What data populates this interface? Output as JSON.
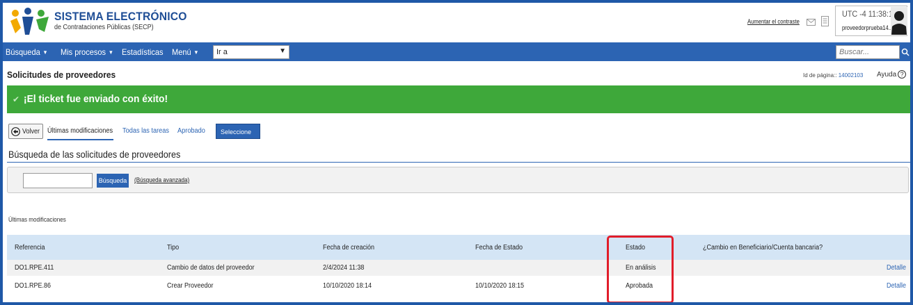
{
  "header": {
    "brand_title": "SISTEMA ELECTRÓNICO",
    "brand_subtitle": "de Contrataciones Públicas (SECP)",
    "contrast_link": "Aumentar el contraste",
    "time": "UTC -4 11:38:17",
    "username": "proveedorprueba14..."
  },
  "nav": {
    "items": [
      {
        "label": "Búsqueda",
        "caret": true
      },
      {
        "label": "Mis procesos",
        "caret": true
      },
      {
        "label": "Estadísticas",
        "caret": false
      },
      {
        "label": "Menú",
        "caret": true
      }
    ],
    "goto_value": "Ir a",
    "search_placeholder": "Buscar..."
  },
  "page": {
    "title": "Solicitudes de proveedores",
    "page_id_label": "Id de página::",
    "page_id": "14002103",
    "help_label": "Ayuda",
    "help_symbol": "?"
  },
  "banner": {
    "message": "¡El ticket fue enviado con éxito!",
    "color": "#3ea83a"
  },
  "tabs": {
    "back_label": "Volver",
    "items": [
      "Últimas modificaciones",
      "Todas las tareas",
      "Aprobado"
    ],
    "active": "Últimas modificaciones",
    "select_label": "Seleccione"
  },
  "search": {
    "section_title": "Búsqueda de las solicitudes de proveedores",
    "query_value": "",
    "button_label": "Búsqueda",
    "advanced_link": "(Búsqueda avanzada)"
  },
  "list": {
    "caption": "Últimas modificaciones",
    "columns": [
      "Referencia",
      "Tipo",
      "Fecha de creación",
      "Fecha de Estado",
      "Estado",
      "¿Cambio en Beneficiario/Cuenta bancaria?"
    ],
    "rows": [
      {
        "referencia": "DO1.RPE.411",
        "tipo": "Cambio de datos del proveedor",
        "fecha_creacion": "2/4/2024 11:38",
        "fecha_estado": "",
        "estado": "En análisis",
        "cambio": "",
        "action": "Detalle"
      },
      {
        "referencia": "DO1.RPE.86",
        "tipo": "Crear Proveedor",
        "fecha_creacion": "10/10/2020 18:14",
        "fecha_estado": "10/10/2020 18:15",
        "estado": "Aprobada",
        "cambio": "",
        "action": "Detalle"
      }
    ]
  },
  "colors": {
    "primary": "#2c64b3",
    "highlight": "#e11d2a",
    "table_header": "#d4e5f5"
  }
}
